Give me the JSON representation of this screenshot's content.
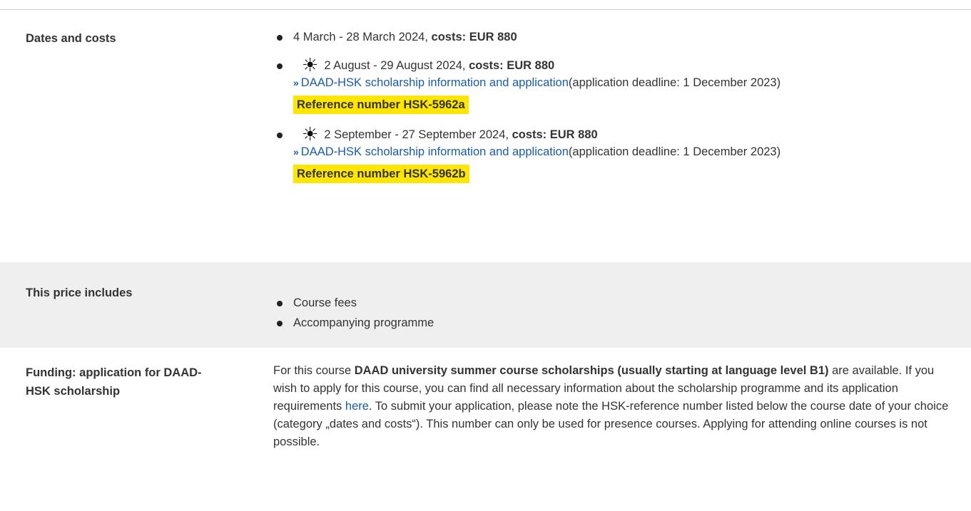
{
  "dates_costs": {
    "label": "Dates and costs",
    "items": [
      {
        "dates": "4 March - 28 March 2024, ",
        "costs": "costs: EUR 880"
      },
      {
        "icon": "sun-icon",
        "dates": "2 August - 29 August 2024, ",
        "costs": "costs: EUR 880",
        "link_text": "DAAD-HSK scholarship information and application",
        "deadline": "(application deadline: 1 December 2023)",
        "reference": "Reference number HSK-5962a"
      },
      {
        "icon": "sun-icon",
        "dates": "2 September - 27 September 2024, ",
        "costs": "costs: EUR 880",
        "link_text": "DAAD-HSK scholarship information and application",
        "deadline": "(application deadline: 1 December 2023)",
        "reference": "Reference number HSK-5962b"
      }
    ]
  },
  "price_includes": {
    "label": "This price includes",
    "items": [
      "Course fees",
      "Accompanying programme"
    ]
  },
  "funding": {
    "label": "Funding: application for DAAD-HSK scholarship",
    "text_1": "For this course ",
    "bold_1": "DAAD university summer course scholarships (usually starting at language level B1)",
    "text_2": " are available. If you wish to apply for this course, you can find all necessary information about the scholarship programme and its application requirements ",
    "link": "here",
    "text_3": ". To submit your application, please note the HSK-reference number listed below the course date of your choice (category „dates and costs“). This number can only be used for presence courses. Applying for attending online courses is not possible."
  },
  "colors": {
    "link": "#1a5ca8",
    "highlight": "#ffe600",
    "row_shade": "#efefef"
  }
}
